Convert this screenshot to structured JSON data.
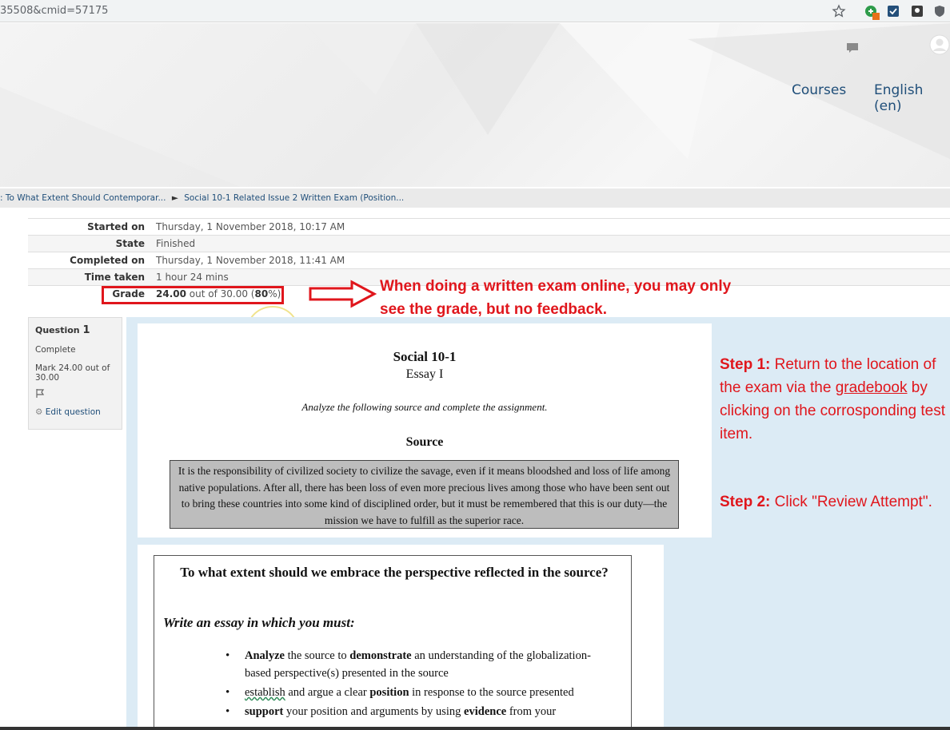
{
  "browser": {
    "url_fragment": "35508&cmid=57175",
    "icons": [
      "star-icon",
      "extension-badge-icon",
      "extension-icon-2",
      "extension-icon-3",
      "shield-extension-icon"
    ],
    "extension_badge": "1"
  },
  "header": {
    "nav": {
      "courses": "Courses",
      "language": "English (en)"
    },
    "icons": [
      "chat-icon",
      "user-avatar-icon"
    ]
  },
  "breadcrumb": {
    "item1": ": To What Extent Should Contemporar...",
    "separator": "►",
    "item2": "Social 10-1 Related Issue 2 Written Exam (Position..."
  },
  "summary": {
    "rows": [
      {
        "label": "Started on",
        "value": "Thursday, 1 November 2018, 10:17 AM"
      },
      {
        "label": "State",
        "value": "Finished"
      },
      {
        "label": "Completed on",
        "value": "Thursday, 1 November 2018, 11:41 AM"
      },
      {
        "label": "Time taken",
        "value": "1 hour 24 mins"
      }
    ],
    "grade": {
      "label": "Grade",
      "score": "24.00",
      "mid": " out of 30.00 (",
      "percent": "80",
      "end": "%)"
    }
  },
  "annotations": {
    "note1": "When doing a written exam online, you may only see the grade, but no feedback.",
    "step1_label": "Step 1:",
    "step1_pre": " Return to the location of the exam via the ",
    "step1_link": "gradebook",
    "step1_post": " by clicking on the corrosponding test item.",
    "step2_label": "Step 2:",
    "step2_text": " Click \"Review Attempt\".",
    "accent_color": "#e0161c"
  },
  "question_info": {
    "question_label": "Question",
    "question_number": "1",
    "status": "Complete",
    "mark": "Mark 24.00 out of 30.00",
    "edit_label": "Edit question"
  },
  "exam": {
    "title": "Social 10-1",
    "subtitle": "Essay I",
    "instruction": "Analyze the following source and complete the assignment.",
    "source_heading": "Source",
    "source_text": "It is the responsibility of civilized society to civilize the savage, even if it means bloodshed and loss of life among native populations. After all, there has been loss of even more precious lives among those who have been sent out to bring these countries into some kind of disciplined order, but it must be remembered that this is our duty—the mission we have to fulfill as the superior race.",
    "prompt": "To what extent should we embrace the perspective reflected in the source?",
    "write_heading": "Write an essay in which you must:",
    "bullets": [
      {
        "b1": "Analyze",
        "t1": " the source to ",
        "b2": "demonstrate",
        "t2": " an understanding of the globalization-based perspective(s) presented in the source"
      },
      {
        "u1": "establish",
        "t1": " and argue a clear ",
        "b2": "position",
        "t2": " in response to the source presented"
      },
      {
        "b1": "support",
        "t1": " your position and arguments by using ",
        "b2": "evidence",
        "t2": " from your"
      }
    ]
  }
}
